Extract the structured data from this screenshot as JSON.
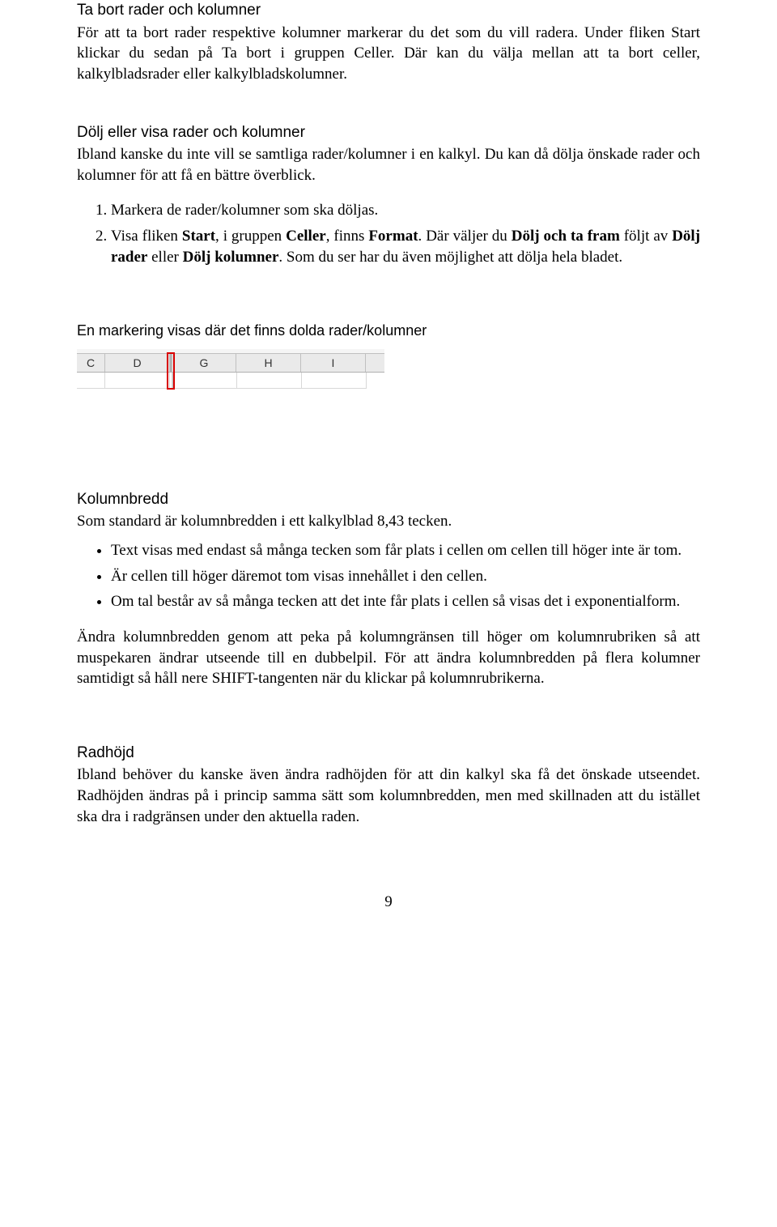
{
  "section_delete": {
    "heading": "Ta bort rader och kolumner",
    "body": "För att ta bort rader respektive kolumner markerar du det som du vill radera. Under fliken Start klickar du sedan på Ta bort i gruppen Celler. Där kan du välja mellan att ta bort celler, kalkylbladsrader eller kalkylbladskolumner."
  },
  "section_hide": {
    "heading": "Dölj eller visa rader och kolumner",
    "intro": "Ibland kanske du inte vill se samtliga rader/kolumner i en kalkyl. Du kan då dölja önskade rader och kolumner för att få en bättre överblick.",
    "steps": [
      "Markera de rader/kolumner som ska döljas.",
      "Visa fliken <b>Start</b>, i gruppen <b>Celler</b>, finns <b>Format</b>. Där väljer du <b>Dölj och ta fram</b> följt av <b>Dölj rader</b> eller <b>Dölj kolumner</b>. Som du ser har du även möjlighet att dölja hela bladet."
    ],
    "marker_caption": "En markering visas där det finns dolda rader/kolumner"
  },
  "excel": {
    "cols": {
      "c": "C",
      "d": "D",
      "g": "G",
      "h": "H",
      "i": "I"
    }
  },
  "section_colwidth": {
    "heading": "Kolumnbredd",
    "intro": "Som standard är kolumnbredden i ett kalkylblad 8,43 tecken.",
    "bullets": [
      "Text visas med endast så många tecken som får plats i cellen om cellen till höger inte är tom.",
      "Är cellen till höger däremot tom visas innehållet i den cellen.",
      "Om tal består av så många tecken att det inte får plats i cellen så visas det i exponentialform."
    ],
    "after": "Ändra kolumnbredden genom att peka på kolumngränsen till höger om kolumnrubriken så att muspekaren ändrar utseende till en dubbelpil. För att ändra kolumnbredden på flera kolumner samtidigt så håll nere SHIFT-tangenten när du klickar på kolumnrubrikerna."
  },
  "section_rowheight": {
    "heading": "Radhöjd",
    "body": "Ibland behöver du kanske även ändra radhöjden för att din kalkyl ska få det önskade utseendet. Radhöjden ändras på i princip samma sätt som kolumnbredden, men med skillnaden att du istället ska dra i radgränsen under den aktuella raden."
  },
  "page_number": "9"
}
